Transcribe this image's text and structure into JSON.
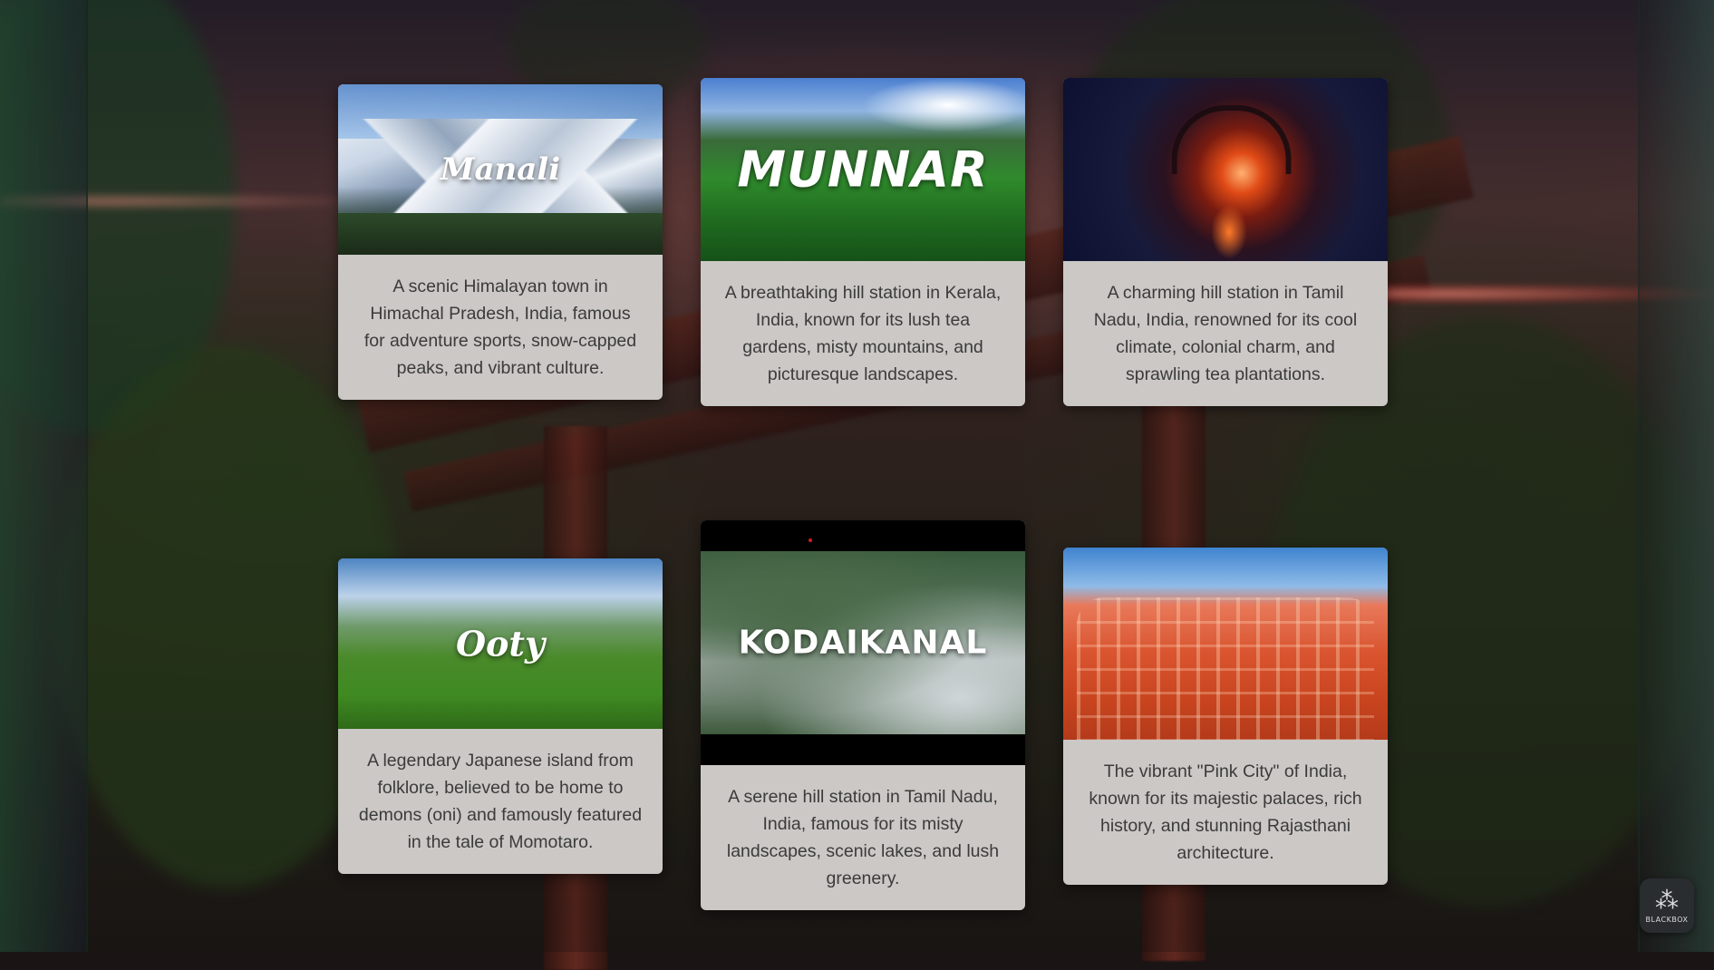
{
  "cards": [
    {
      "image_title": "Manali",
      "description": "A scenic Himalayan town in Himachal Pradesh, India, famous for adventure sports, snow-capped peaks, and vibrant culture."
    },
    {
      "image_title": "MUNNAR",
      "description": "A breathtaking hill station in Kerala, India, known for its lush tea gardens, misty mountains, and picturesque landscapes."
    },
    {
      "image_title": "",
      "description": "A charming hill station in Tamil Nadu, India, renowned for its cool climate, colonial charm, and sprawling tea plantations."
    },
    {
      "image_title": "Ooty",
      "description": "A legendary Japanese island from folklore, believed to be home to demons (oni) and famously featured in the tale of Momotaro."
    },
    {
      "image_title": "KODAIKANAL",
      "description": "A serene hill station in Tamil Nadu, India, famous for its misty landscapes, scenic lakes, and lush greenery."
    },
    {
      "image_title": "",
      "description": "The vibrant \"Pink City\" of India, known for its majestic palaces, rich history, and stunning Rajasthani architecture."
    }
  ],
  "widget": {
    "label": "BLACKBOX",
    "icon": "blackbox-logo-icon"
  },
  "colors": {
    "card_background": "#cbc8c5",
    "card_text": "#3b3b3b",
    "widget_background": "#2a2d30"
  }
}
